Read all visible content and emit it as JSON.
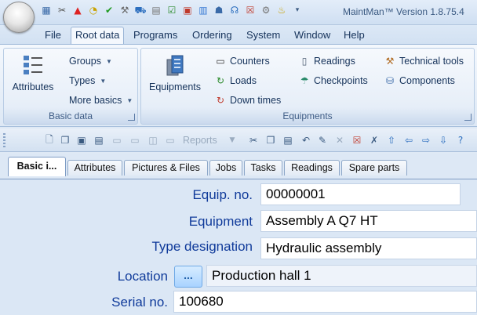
{
  "window": {
    "title": "MaintMan™ Version 1.8.75.4"
  },
  "quick_access_icons": [
    "equipment-icon",
    "tools-icon",
    "warning-icon",
    "stopwatch-icon",
    "check-icon",
    "wrench-icon",
    "truck-icon",
    "document-icon",
    "chart-check-icon",
    "calendar-icon",
    "bar-chart-icon",
    "people-icon",
    "headset-icon",
    "report-icon",
    "gears-icon",
    "lightbulb-icon",
    "dropdown-icon"
  ],
  "menu": {
    "file": "File",
    "root_data": "Root data",
    "programs": "Programs",
    "ordering": "Ordering",
    "system": "System",
    "window": "Window",
    "help": "Help",
    "active": "Root data"
  },
  "ribbon": {
    "basic_data": {
      "label": "Basic data",
      "attributes": "Attributes",
      "groups": "Groups",
      "types": "Types",
      "more_basics": "More basics"
    },
    "equipments": {
      "label": "Equipments",
      "equipments": "Equipments",
      "counters": "Counters",
      "loads": "Loads",
      "down_times": "Down times",
      "readings": "Readings",
      "checkpoints": "Checkpoints",
      "technical_tools": "Technical tools",
      "components": "Components"
    }
  },
  "toolbar": {
    "reports": "Reports"
  },
  "record_tabs": [
    {
      "label": "Basic i...",
      "active": true
    },
    {
      "label": "Attributes"
    },
    {
      "label": "Pictures & Files"
    },
    {
      "label": "Jobs"
    },
    {
      "label": "Tasks"
    },
    {
      "label": "Readings"
    },
    {
      "label": "Spare parts"
    }
  ],
  "form": {
    "equip_no_label": "Equip. no.",
    "equip_no": "00000001",
    "equipment_label": "Equipment",
    "equipment": "Assembly A Q7 HT",
    "type_designation_label": "Type designation",
    "type_designation": "Hydraulic assembly",
    "location_label": "Location",
    "location_button": "...",
    "location": "Production hall 1",
    "serial_no_label": "Serial no.",
    "serial_no": "100680"
  },
  "colors": {
    "label_text": "#0f3a9a",
    "ribbon_bg": "#dde8f5",
    "accent_blue": "#1f5fa8"
  }
}
